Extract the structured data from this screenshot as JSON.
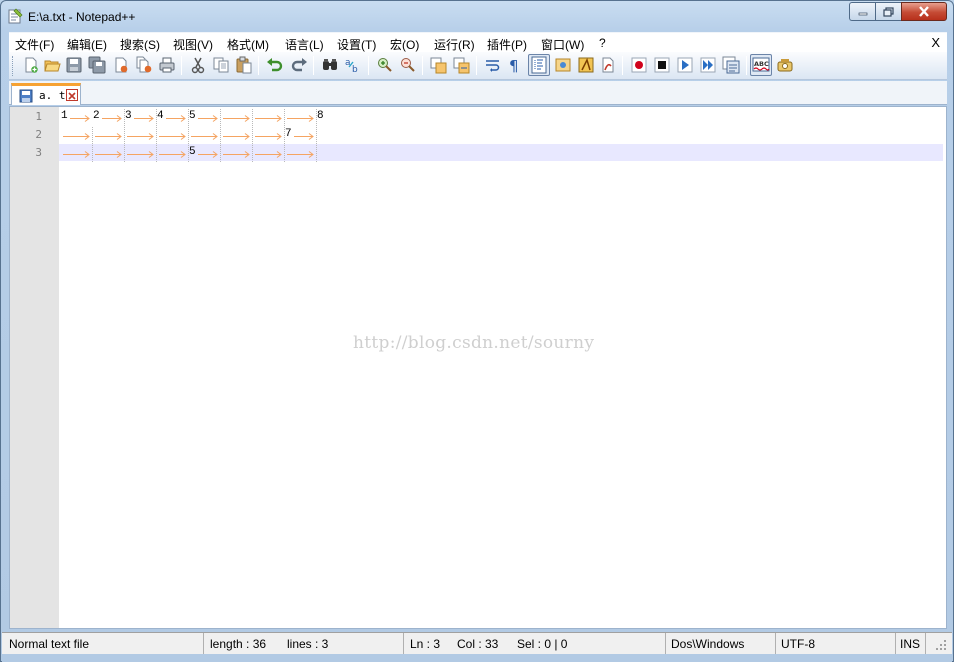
{
  "window": {
    "title": "E:\\a.txt - Notepad++"
  },
  "menubar": {
    "items": [
      "文件(F)",
      "编辑(E)",
      "搜索(S)",
      "视图(V)",
      "格式(M)",
      "语言(L)",
      "设置(T)",
      "宏(O)",
      "运行(R)",
      "插件(P)",
      "窗口(W)",
      "?"
    ],
    "close_label": "X"
  },
  "toolbar": {
    "icons": [
      "new-file-icon",
      "open-file-icon",
      "save-icon",
      "save-all-icon",
      "close-icon",
      "close-all-icon",
      "print-icon",
      "cut-icon",
      "copy-icon",
      "paste-icon",
      "undo-icon",
      "redo-icon",
      "find-icon",
      "replace-icon",
      "zoom-in-icon",
      "zoom-out-icon",
      "sync-vertical-icon",
      "sync-horizontal-icon",
      "word-wrap-icon",
      "show-all-chars-icon",
      "indent-guide-icon",
      "doc-map-icon",
      "function-list-icon",
      "folder-as-workspace-icon",
      "record-macro-icon",
      "stop-macro-icon",
      "play-macro-icon",
      "run-macro-multiple-icon",
      "save-macro-icon",
      "spell-check-icon",
      "plugin-icon"
    ]
  },
  "tab": {
    "label": "a. txt"
  },
  "editor": {
    "line_numbers": [
      "1",
      "2",
      "3"
    ],
    "lines": [
      {
        "segments": [
          "1",
          "2",
          "3",
          "4",
          "5",
          "",
          "",
          "",
          "8"
        ]
      },
      {
        "segments": [
          "",
          "",
          "",
          "",
          "",
          "",
          "",
          "7",
          ""
        ]
      },
      {
        "segments": [
          "",
          "",
          "",
          "",
          "5",
          "",
          "",
          "",
          ""
        ]
      }
    ],
    "watermark": "http://blog.csdn.net/sourny",
    "colors": {
      "tab_arrow": "#f5a462",
      "gutter": "#e4e4e4",
      "current_line": "#e8e8ff"
    }
  },
  "statusbar": {
    "file_type": "Normal text file",
    "length": "length : 36",
    "lines": "lines : 3",
    "ln": "Ln : 3",
    "col": "Col : 33",
    "sel": "Sel : 0 | 0",
    "eol": "Dos\\Windows",
    "encoding": "UTF-8",
    "mode": "INS"
  }
}
